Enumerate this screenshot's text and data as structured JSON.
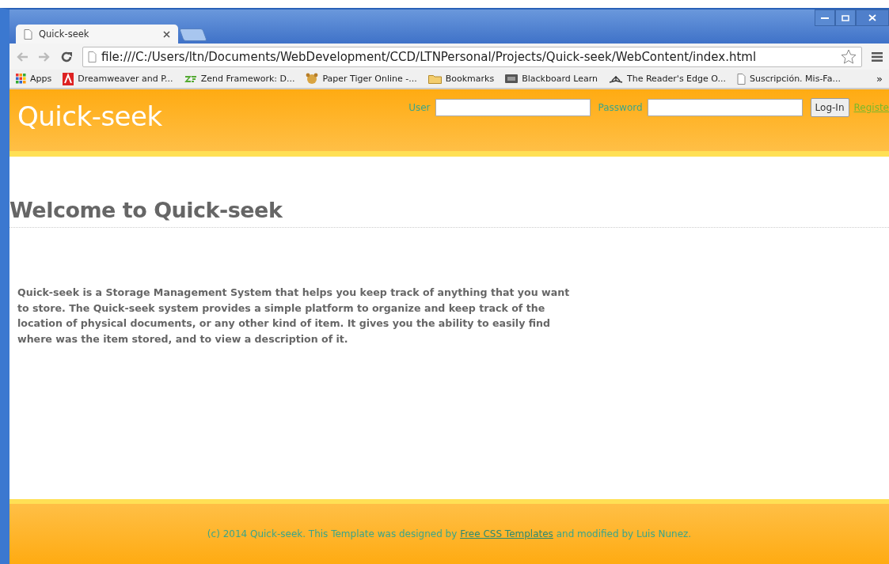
{
  "browser": {
    "tabs": [
      {
        "title": "Quick-seek",
        "selected": true
      }
    ],
    "address": "file:///C:/Users/ltn/Documents/WebDevelopment/CCD/LTNPersonal/Projects/Quick-seek/WebContent/index.html",
    "bookmarks": [
      {
        "label": "Apps",
        "kind": "apps"
      },
      {
        "label": "Dreamweaver and P...",
        "kind": "adobe"
      },
      {
        "label": "Zend Framework: D...",
        "kind": "zend"
      },
      {
        "label": "Paper Tiger Online -...",
        "kind": "tiger"
      },
      {
        "label": "Bookmarks",
        "kind": "folder"
      },
      {
        "label": "Blackboard Learn",
        "kind": "bb"
      },
      {
        "label": "The Reader's Edge O...",
        "kind": "book"
      },
      {
        "label": "Suscripción. Mis-Fa...",
        "kind": "page"
      }
    ],
    "overflow": "»"
  },
  "page": {
    "site_title": "Quick-seek",
    "login": {
      "user_label": "User",
      "password_label": "Password",
      "button": "Log-In",
      "register_link": "Registe"
    },
    "heading": "Welcome to Quick-seek",
    "intro": "Quick-seek is a Storage Management System that helps you keep track of anything that you want to store. The Quick-seek system provides a simple platform to organize and keep track of the location of physical documents, or any other kind of item. It gives you the ability to easily find where was the item stored, and to view a description of it.",
    "footer": {
      "before": "(c) 2014 Quick-seek. This Template was designed by ",
      "link": "Free CSS Templates",
      "after": " and modified by Luis Nunez."
    }
  }
}
